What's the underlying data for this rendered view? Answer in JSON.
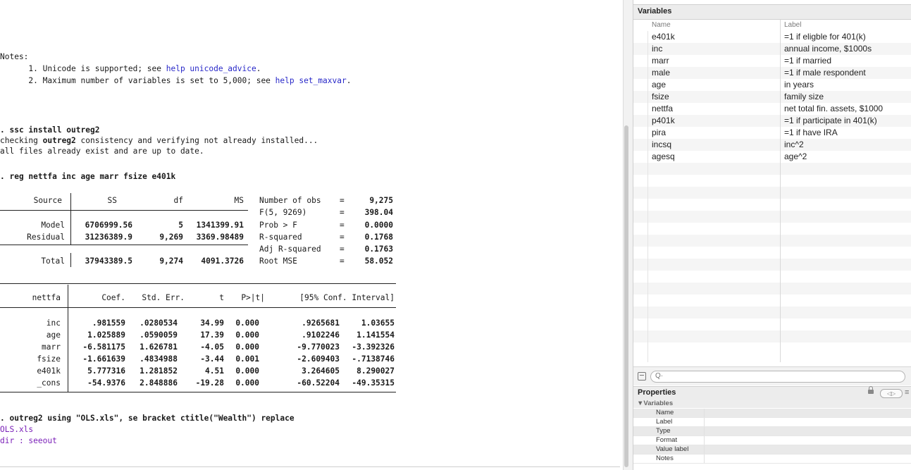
{
  "results": {
    "notes_title": "Notes:",
    "note1_prefix": "      1. Unicode is supported; see ",
    "note1_link": "help unicode_advice",
    "note1_suffix": ".",
    "note2_prefix": "      2. Maximum number of variables is set to 5,000; see ",
    "note2_link": "help set_maxvar",
    "note2_suffix": ".",
    "cmd1": ". ssc install outreg2",
    "out1_a": "checking ",
    "out1_b": "outreg2",
    "out1_c": " consistency and verifying not already installed...",
    "out2": "all files already exist and are up to date.",
    "cmd2": ". reg nettfa inc age marr fsize e401k",
    "anova": {
      "headers": [
        "Source",
        "SS",
        "df",
        "MS"
      ],
      "rows": [
        {
          "source": "Model",
          "ss": "6706999.56",
          "df": "5",
          "ms": "1341399.91"
        },
        {
          "source": "Residual",
          "ss": "31236389.9",
          "df": "9,269",
          "ms": "3369.98489"
        },
        {
          "source": "Total",
          "ss": "37943389.5",
          "df": "9,274",
          "ms": "4091.3726"
        }
      ]
    },
    "stats": [
      {
        "label": "Number of obs",
        "eq": "=",
        "value": "9,275"
      },
      {
        "label": "F(5, 9269)",
        "eq": "=",
        "value": "398.04"
      },
      {
        "label": "Prob > F",
        "eq": "=",
        "value": "0.0000"
      },
      {
        "label": "R-squared",
        "eq": "=",
        "value": "0.1768"
      },
      {
        "label": "Adj R-squared",
        "eq": "=",
        "value": "0.1763"
      },
      {
        "label": "Root MSE",
        "eq": "=",
        "value": "58.052"
      }
    ],
    "coef": {
      "headers": [
        "nettfa",
        "Coef.",
        "Std. Err.",
        "t",
        "P>|t|",
        "[95% Conf. Interval]"
      ],
      "rows": [
        {
          "var": "inc",
          "coef": ".981559",
          "se": ".0280534",
          "t": "34.99",
          "p": "0.000",
          "lo": ".9265681",
          "hi": "1.03655"
        },
        {
          "var": "age",
          "coef": "1.025889",
          "se": ".0590059",
          "t": "17.39",
          "p": "0.000",
          "lo": ".9102246",
          "hi": "1.141554"
        },
        {
          "var": "marr",
          "coef": "-6.581175",
          "se": "1.626781",
          "t": "-4.05",
          "p": "0.000",
          "lo": "-9.770023",
          "hi": "-3.392326"
        },
        {
          "var": "fsize",
          "coef": "-1.661639",
          "se": ".4834988",
          "t": "-3.44",
          "p": "0.001",
          "lo": "-2.609403",
          "hi": "-.7138746"
        },
        {
          "var": "e401k",
          "coef": "5.777316",
          "se": "1.281852",
          "t": "4.51",
          "p": "0.000",
          "lo": "3.264605",
          "hi": "8.290027"
        },
        {
          "var": "_cons",
          "coef": "-54.9376",
          "se": "2.848886",
          "t": "-19.28",
          "p": "0.000",
          "lo": "-60.52204",
          "hi": "-49.35315"
        }
      ]
    },
    "cmd3": ". outreg2 using \"OLS.xls\", se bracket ctitle(\"Wealth\") replace",
    "out3": "OLS.xls",
    "out4": "dir : seeout"
  },
  "variables_panel": {
    "title": "Variables",
    "col_name": "Name",
    "col_label": "Label",
    "items": [
      {
        "name": "e401k",
        "label": "=1 if eligble for 401(k)"
      },
      {
        "name": "inc",
        "label": "annual income, $1000s"
      },
      {
        "name": "marr",
        "label": "=1 if married"
      },
      {
        "name": "male",
        "label": "=1 if male respondent"
      },
      {
        "name": "age",
        "label": "in years"
      },
      {
        "name": "fsize",
        "label": "family size"
      },
      {
        "name": "nettfa",
        "label": "net total fin. assets, $1000"
      },
      {
        "name": "p401k",
        "label": "=1 if participate in 401(k)"
      },
      {
        "name": "pira",
        "label": "=1 if have IRA"
      },
      {
        "name": "incsq",
        "label": "inc^2"
      },
      {
        "name": "agesq",
        "label": "age^2"
      }
    ],
    "search_glyph": "Q·"
  },
  "properties_panel": {
    "title": "Properties",
    "section": "▼Variables",
    "nav_arrows": "◁▷",
    "menu_glyph": "≡",
    "fields": [
      "Name",
      "Label",
      "Type",
      "Format",
      "Value label",
      "Notes"
    ]
  }
}
